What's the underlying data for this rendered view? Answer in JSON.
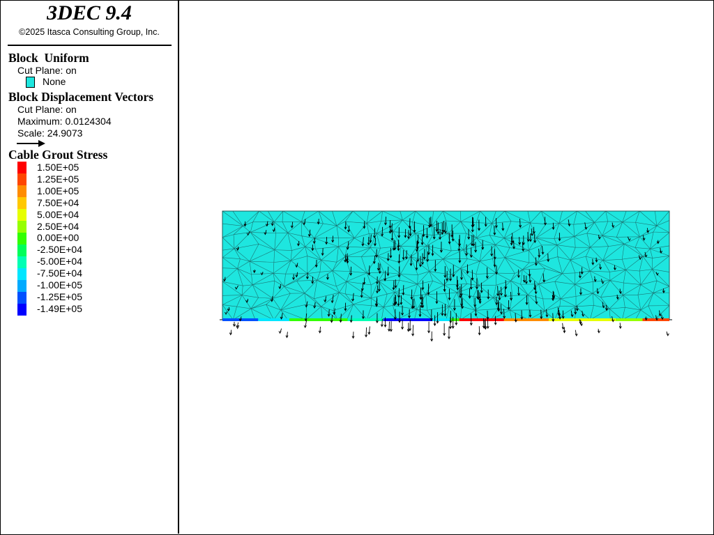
{
  "app": {
    "title": "3DEC 9.4",
    "copyright": "©2025 Itasca Consulting Group, Inc."
  },
  "legend": {
    "block_uniform": {
      "heading": "Block  Uniform",
      "cut_plane": "Cut Plane: on",
      "swatch_color": "#1ee6df",
      "swatch_label": "None"
    },
    "displacement_vectors": {
      "heading": "Block Displacement Vectors",
      "cut_plane": "Cut Plane: on",
      "maximum": "Maximum: 0.0124304",
      "scale": "Scale: 24.9073",
      "arrow_icon": "arrow-right-icon"
    },
    "cable_grout_stress": {
      "heading": "Cable Grout Stress",
      "entries": [
        {
          "label": "1.50E+05",
          "color": "#ff0000"
        },
        {
          "label": "1.25E+05",
          "color": "#ff4600"
        },
        {
          "label": "1.00E+05",
          "color": "#ff8c00"
        },
        {
          "label": "7.50E+04",
          "color": "#ffc800"
        },
        {
          "label": "5.00E+04",
          "color": "#e6ff00"
        },
        {
          "label": "2.50E+04",
          "color": "#96ff00"
        },
        {
          "label": "0.00E+00",
          "color": "#32ff00"
        },
        {
          "label": "-2.50E+04",
          "color": "#00ff5a"
        },
        {
          "label": "-5.00E+04",
          "color": "#00ffb4"
        },
        {
          "label": "-7.50E+04",
          "color": "#00e6ff"
        },
        {
          "label": "-1.00E+05",
          "color": "#00aaff"
        },
        {
          "label": "-1.25E+05",
          "color": "#0050ff"
        },
        {
          "label": "-1.49E+05",
          "color": "#0000ff"
        }
      ]
    }
  },
  "model": {
    "block_color": "#1ee6df",
    "mesh_color": "#1a5a5a",
    "vector_color": "#000000",
    "cable_segments": [
      {
        "from": 0.0,
        "to": 0.08,
        "color": "#0050ff"
      },
      {
        "from": 0.08,
        "to": 0.15,
        "color": "#00e6ff"
      },
      {
        "from": 0.15,
        "to": 0.28,
        "color": "#32ff00"
      },
      {
        "from": 0.28,
        "to": 0.36,
        "color": "#00ffb4"
      },
      {
        "from": 0.36,
        "to": 0.47,
        "color": "#0000ff"
      },
      {
        "from": 0.47,
        "to": 0.51,
        "color": "#00e6ff"
      },
      {
        "from": 0.51,
        "to": 0.53,
        "color": "#32ff00"
      },
      {
        "from": 0.53,
        "to": 0.63,
        "color": "#ff0000"
      },
      {
        "from": 0.63,
        "to": 0.73,
        "color": "#ff8c00"
      },
      {
        "from": 0.73,
        "to": 0.88,
        "color": "#e6ff00"
      },
      {
        "from": 0.88,
        "to": 0.94,
        "color": "#96ff00"
      },
      {
        "from": 0.94,
        "to": 1.0,
        "color": "#ff4600"
      }
    ]
  }
}
